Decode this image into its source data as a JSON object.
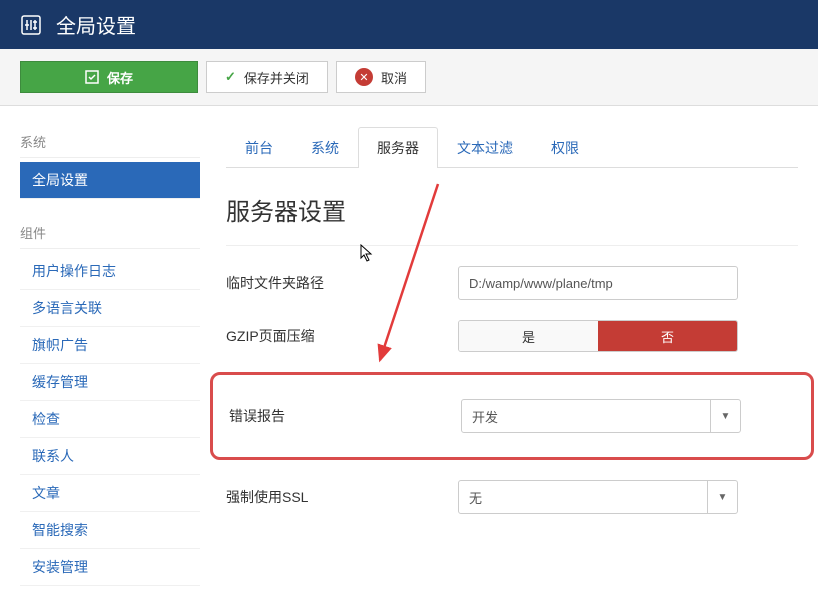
{
  "header": {
    "title": "全局设置"
  },
  "toolbar": {
    "save": "保存",
    "saveClose": "保存并关闭",
    "cancel": "取消"
  },
  "sidebar": {
    "group1": {
      "heading": "系统",
      "items": [
        "全局设置"
      ]
    },
    "group2": {
      "heading": "组件",
      "items": [
        "用户操作日志",
        "多语言关联",
        "旗帜广告",
        "缓存管理",
        "检查",
        "联系人",
        "文章",
        "智能搜索",
        "安装管理"
      ]
    }
  },
  "tabs": [
    "前台",
    "系统",
    "服务器",
    "文本过滤",
    "权限"
  ],
  "activeTab": "服务器",
  "sectionTitle": "服务器设置",
  "form": {
    "tempPath": {
      "label": "临时文件夹路径",
      "value": "D:/wamp/www/plane/tmp"
    },
    "gzip": {
      "label": "GZIP页面压缩",
      "yes": "是",
      "no": "否"
    },
    "errorReport": {
      "label": "错误报告",
      "value": "开发"
    },
    "forceSSL": {
      "label": "强制使用SSL",
      "value": "无"
    }
  }
}
